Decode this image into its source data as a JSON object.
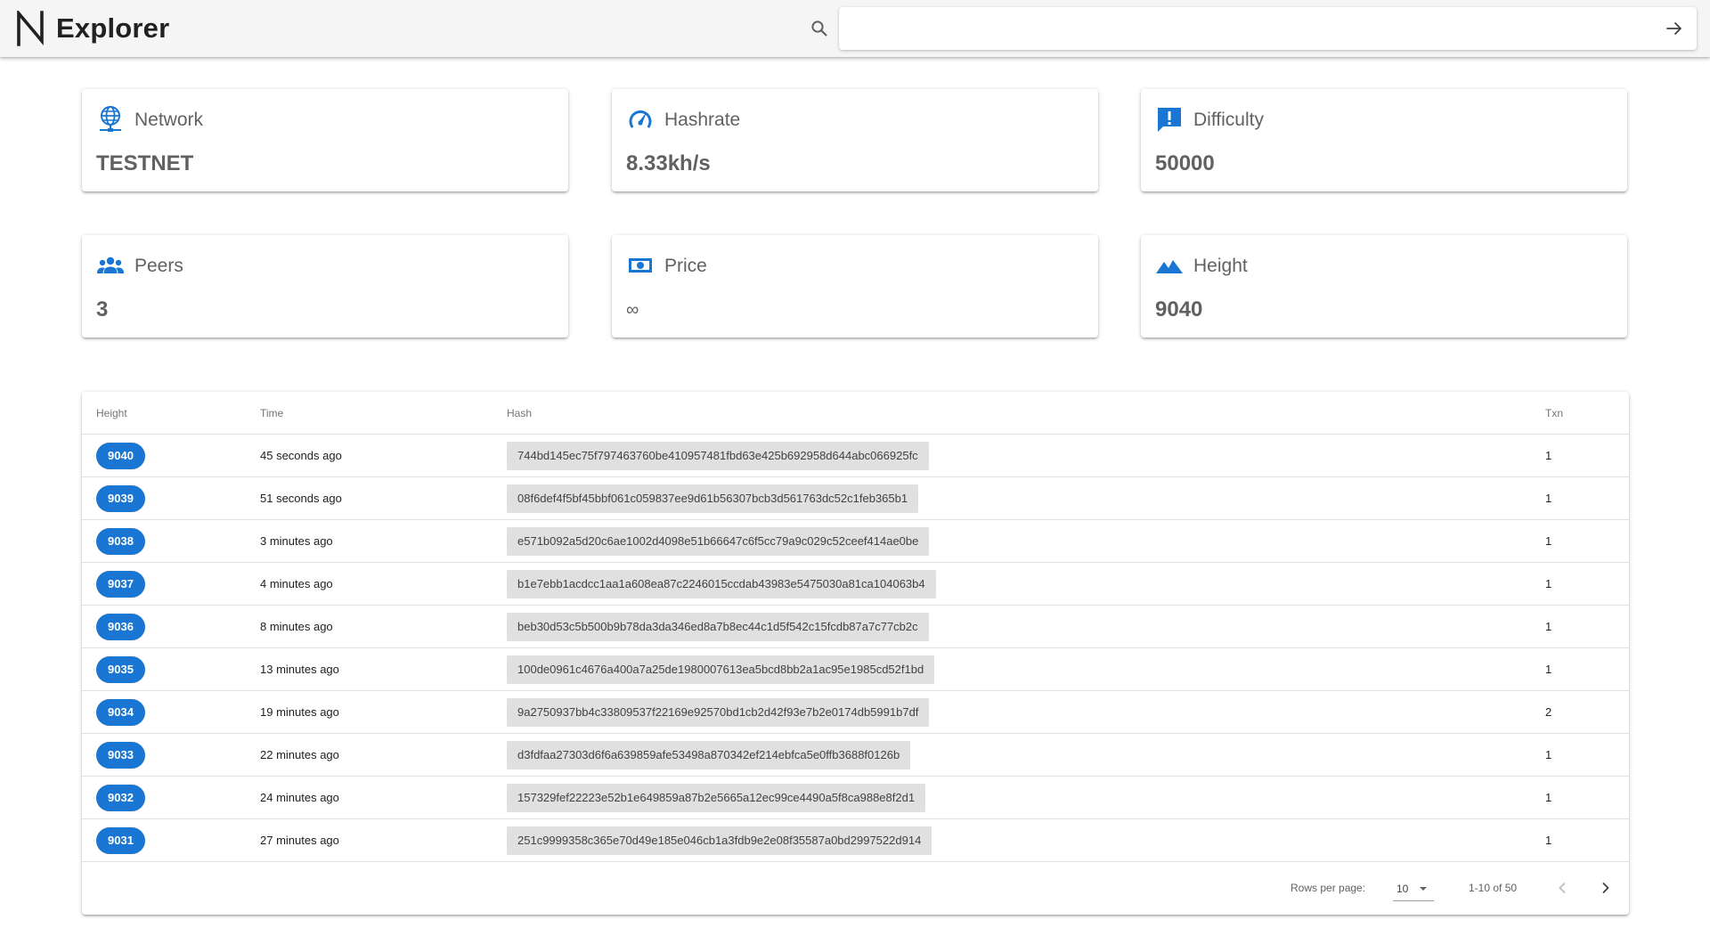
{
  "app": {
    "title": "Explorer",
    "logo": "n-logo",
    "accent_color": "#1976d2"
  },
  "search": {
    "placeholder": "",
    "value": "",
    "icon": "search-icon",
    "submit_icon": "arrow-right-icon"
  },
  "stats": [
    {
      "label": "Network",
      "value": "TESTNET",
      "icon": "globe-network-icon"
    },
    {
      "label": "Hashrate",
      "value": "8.33kh/s",
      "icon": "speedometer-icon"
    },
    {
      "label": "Difficulty",
      "value": "50000",
      "icon": "feedback-exclamation-icon"
    },
    {
      "label": "Peers",
      "value": "3",
      "icon": "people-group-icon"
    },
    {
      "label": "Price",
      "value": "∞",
      "icon": "banknote-icon"
    },
    {
      "label": "Height",
      "value": "9040",
      "icon": "mountain-icon"
    }
  ],
  "table": {
    "columns": [
      "Height",
      "Time",
      "Hash",
      "Txn"
    ],
    "rows": [
      {
        "height": "9040",
        "time": "45 seconds ago",
        "hash": "744bd145ec75f797463760be410957481fbd63e425b692958d644abc066925fc",
        "txn": "1"
      },
      {
        "height": "9039",
        "time": "51 seconds ago",
        "hash": "08f6def4f5bf45bbf061c059837ee9d61b56307bcb3d561763dc52c1feb365b1",
        "txn": "1"
      },
      {
        "height": "9038",
        "time": "3 minutes ago",
        "hash": "e571b092a5d20c6ae1002d4098e51b66647c6f5cc79a9c029c52ceef414ae0be",
        "txn": "1"
      },
      {
        "height": "9037",
        "time": "4 minutes ago",
        "hash": "b1e7ebb1acdcc1aa1a608ea87c2246015ccdab43983e5475030a81ca104063b4",
        "txn": "1"
      },
      {
        "height": "9036",
        "time": "8 minutes ago",
        "hash": "beb30d53c5b500b9b78da3da346ed8a7b8ec44c1d5f542c15fcdb87a7c77cb2c",
        "txn": "1"
      },
      {
        "height": "9035",
        "time": "13 minutes ago",
        "hash": "100de0961c4676a400a7a25de1980007613ea5bcd8bb2a1ac95e1985cd52f1bd",
        "txn": "1"
      },
      {
        "height": "9034",
        "time": "19 minutes ago",
        "hash": "9a2750937bb4c33809537f22169e92570bd1cb2d42f93e7b2e0174db5991b7df",
        "txn": "2"
      },
      {
        "height": "9033",
        "time": "22 minutes ago",
        "hash": "d3fdfaa27303d6f6a639859afe53498a870342ef214ebfca5e0ffb3688f0126b",
        "txn": "1"
      },
      {
        "height": "9032",
        "time": "24 minutes ago",
        "hash": "157329fef22223e52b1e649859a87b2e5665a12ec99ce4490a5f8ca988e8f2d1",
        "txn": "1"
      },
      {
        "height": "9031",
        "time": "27 minutes ago",
        "hash": "251c9999358c365e70d49e185e046cb1a3fdb9e2e08f35587a0bd2997522d914",
        "txn": "1"
      }
    ]
  },
  "pagination": {
    "rows_per_page_label": "Rows per page:",
    "rows_per_page_value": "10",
    "range_text": "1-10 of 50",
    "prev_icon": "chevron-left-icon",
    "next_icon": "chevron-right-icon"
  }
}
